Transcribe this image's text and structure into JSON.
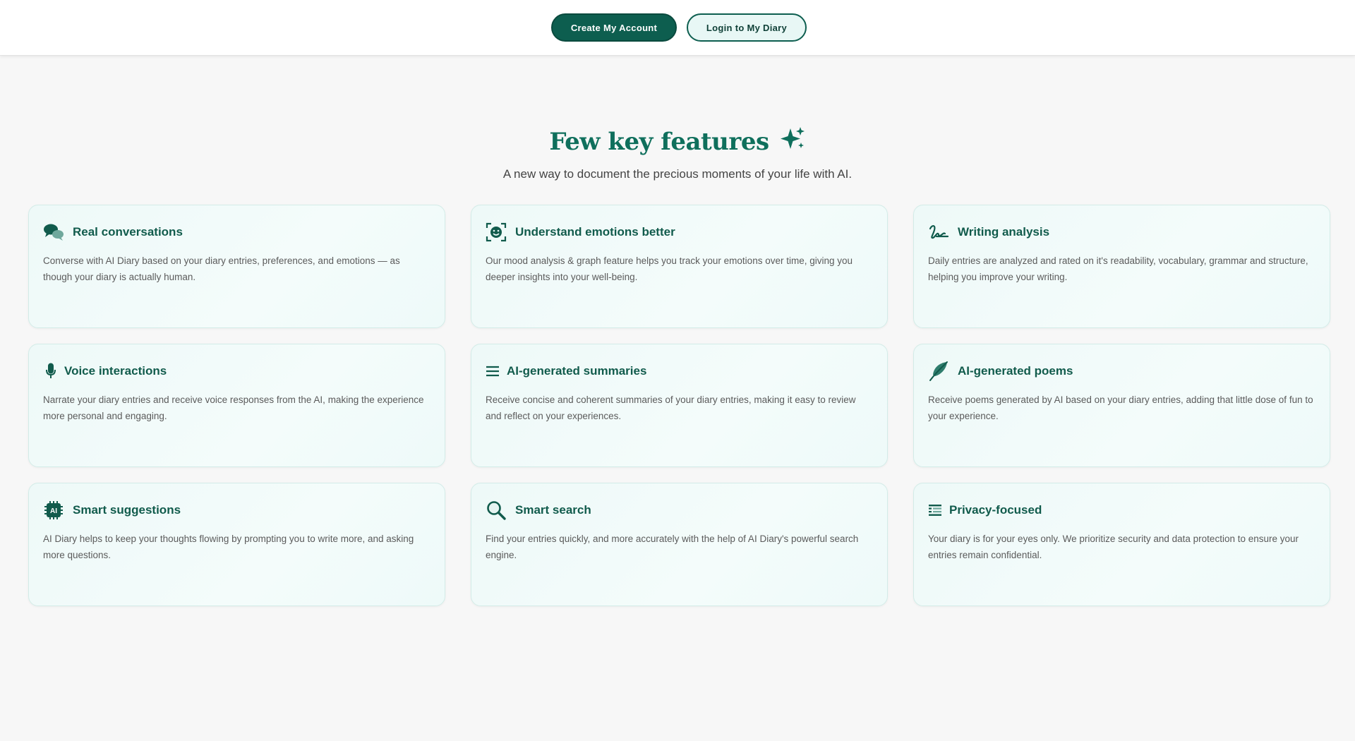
{
  "header": {
    "create_account_label": "Create My Account",
    "login_label": "Login to My Diary"
  },
  "hero": {
    "title": "Few key features",
    "subtitle": "A new way to document the precious moments of your life with AI."
  },
  "colors": {
    "brand_dark": "#0d5e4f",
    "title_green": "#0f6f5c",
    "card_bg": "#eef9f8"
  },
  "features": [
    {
      "icon": "chat-bubbles-icon",
      "title": "Real conversations",
      "text": "Converse with AI Diary based on your diary entries, preferences, and emotions — as though your diary is actually human."
    },
    {
      "icon": "face-scan-icon",
      "title": "Understand emotions better",
      "text": "Our mood analysis & graph feature helps you track your emotions over time, giving you deeper insights into your well-being."
    },
    {
      "icon": "signature-icon",
      "title": "Writing analysis",
      "text": "Daily entries are analyzed and rated on it's readability, vocabulary, grammar and structure, helping you improve your writing."
    },
    {
      "icon": "microphone-icon",
      "title": "Voice interactions",
      "text": "Narrate your diary entries and receive voice responses from the AI, making the experience more personal and engaging."
    },
    {
      "icon": "list-lines-icon",
      "title": "AI-generated summaries",
      "text": "Receive concise and coherent summaries of your diary entries, making it easy to review and reflect on your experiences."
    },
    {
      "icon": "feather-quill-icon",
      "title": "AI-generated poems",
      "text": "Receive poems generated by AI based on your diary entries, adding that little dose of fun to your experience."
    },
    {
      "icon": "ai-chip-icon",
      "title": "Smart suggestions",
      "text": "AI Diary helps to keep your thoughts flowing by prompting you to write more, and asking more questions."
    },
    {
      "icon": "magnifier-icon",
      "title": "Smart search",
      "text": "Find your entries quickly, and more accurately with the help of AI Diary's powerful search engine."
    },
    {
      "icon": "privacy-list-icon",
      "title": "Privacy-focused",
      "text": "Your diary is for your eyes only. We prioritize security and data protection to ensure your entries remain confidential."
    }
  ]
}
